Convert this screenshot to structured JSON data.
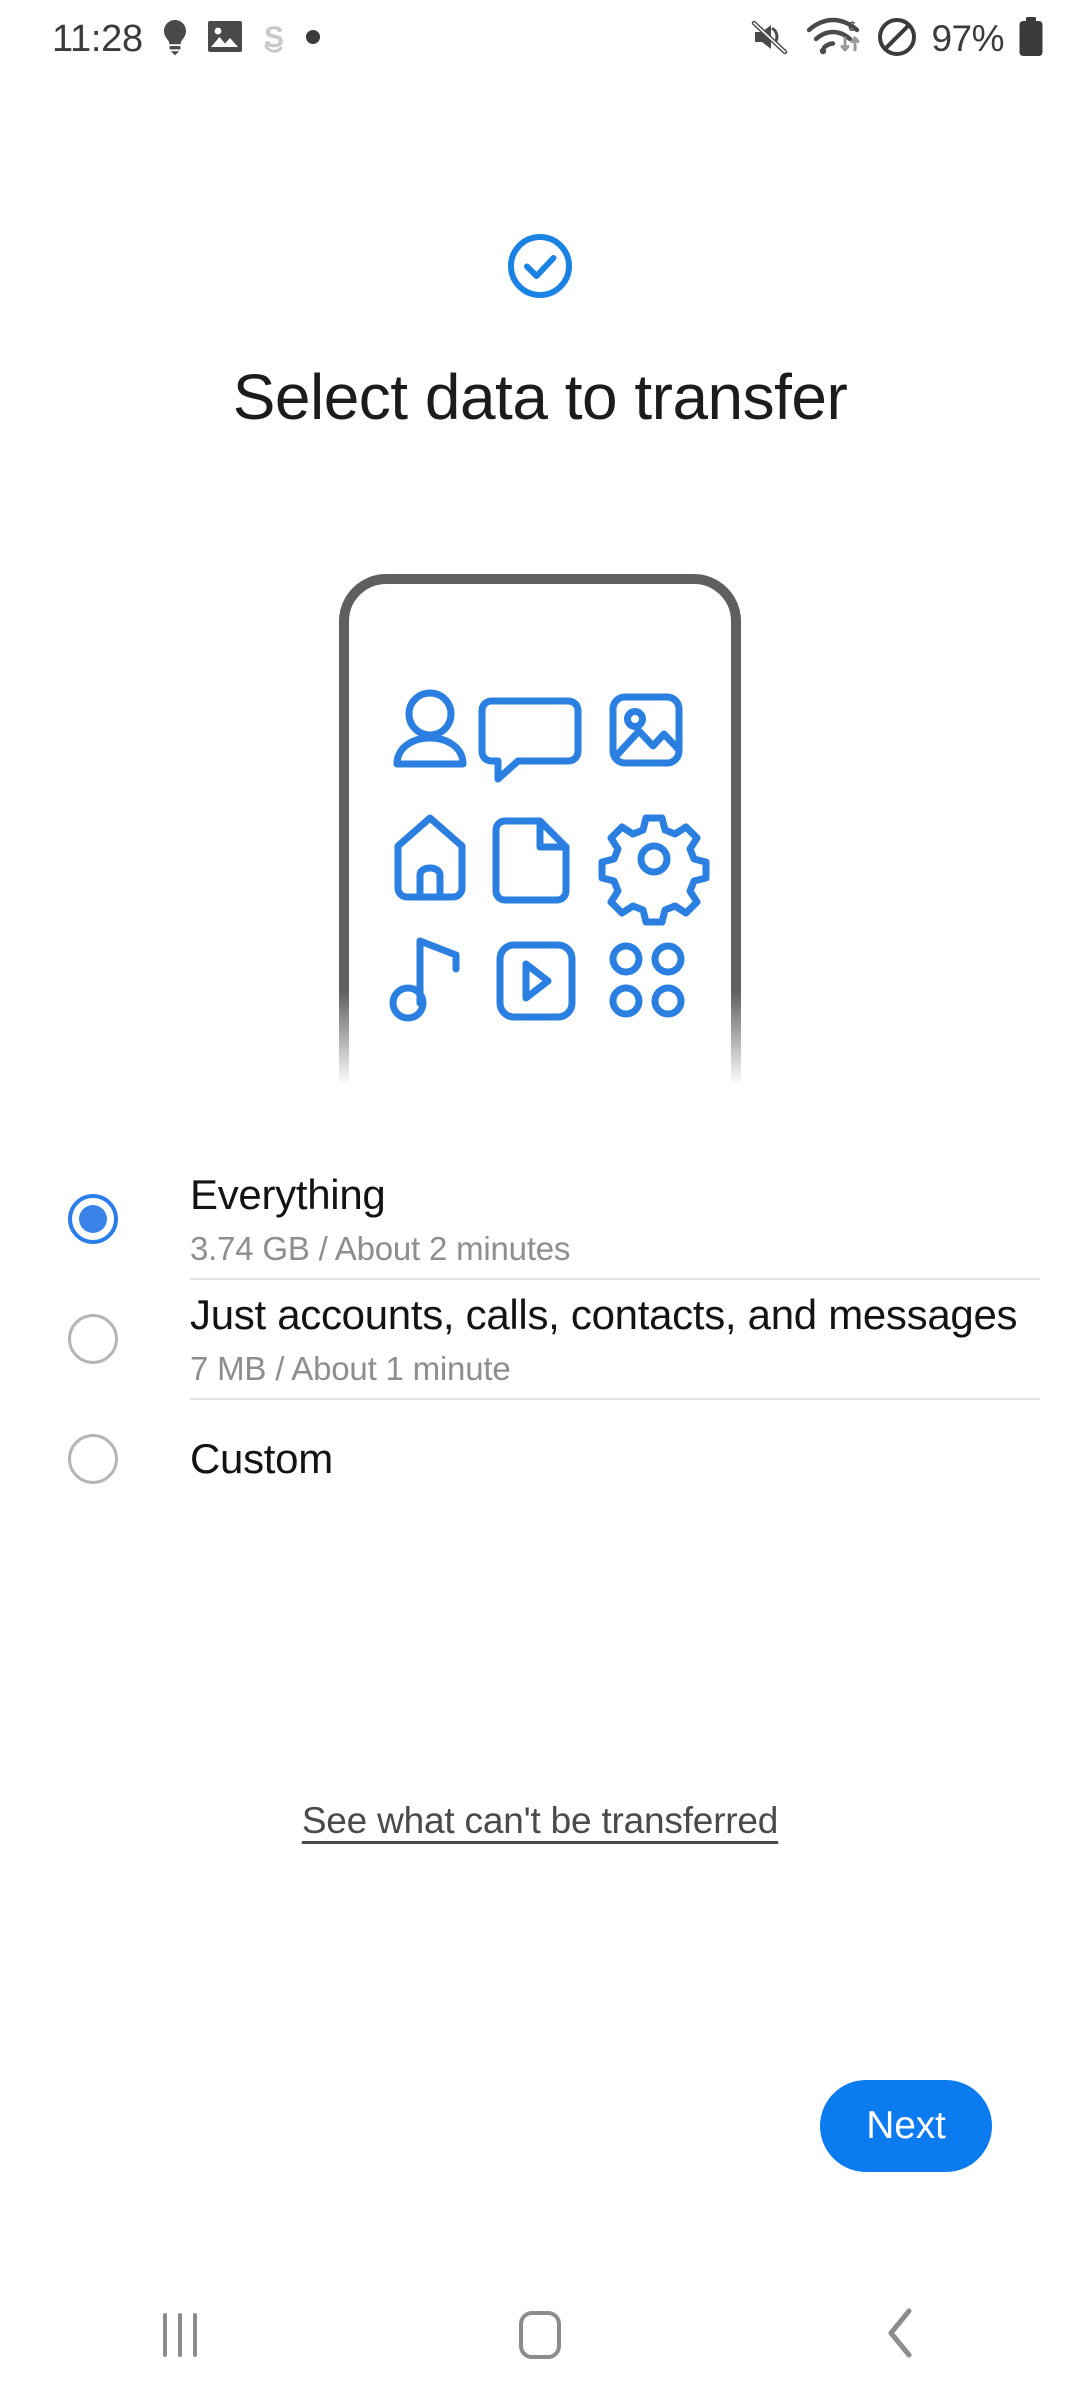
{
  "status_bar": {
    "time": "11:28",
    "battery_percent": "97%",
    "left_icons": [
      "lightbulb-icon",
      "gallery-image-icon",
      "samsung-s-icon",
      "dot-icon"
    ],
    "right_icons": [
      "mute-volume-icon",
      "wifi-6-icon",
      "do-not-disturb-icon",
      "battery-icon"
    ],
    "wifi_generation": "6"
  },
  "header": {
    "icon": "check-circle-icon",
    "title": "Select data to transfer",
    "accent_color": "#1a82e2"
  },
  "illustration": {
    "name": "phone-with-data-icons",
    "outline_color": "#5f5f5f",
    "icon_color": "#2b7fe0",
    "icons": [
      "contact-person-icon",
      "message-bubble-icon",
      "photo-image-icon",
      "home-icon",
      "document-file-icon",
      "settings-gear-icon",
      "music-note-icon",
      "video-play-icon",
      "apps-grid-icon"
    ]
  },
  "options": [
    {
      "id": "everything",
      "label": "Everything",
      "sublabel": "3.74 GB / About 2 minutes",
      "selected": true
    },
    {
      "id": "accounts-calls-contacts-messages",
      "label": "Just accounts, calls, contacts, and messages",
      "sublabel": "7 MB / About 1 minute",
      "selected": false
    },
    {
      "id": "custom",
      "label": "Custom",
      "sublabel": "",
      "selected": false
    }
  ],
  "link": {
    "label": "See what can't be transferred"
  },
  "primary_button": {
    "label": "Next",
    "color": "#0d7bf0"
  },
  "nav_bar": {
    "recents_label": "recents-icon",
    "home_label": "home-icon",
    "back_label": "back-icon"
  }
}
